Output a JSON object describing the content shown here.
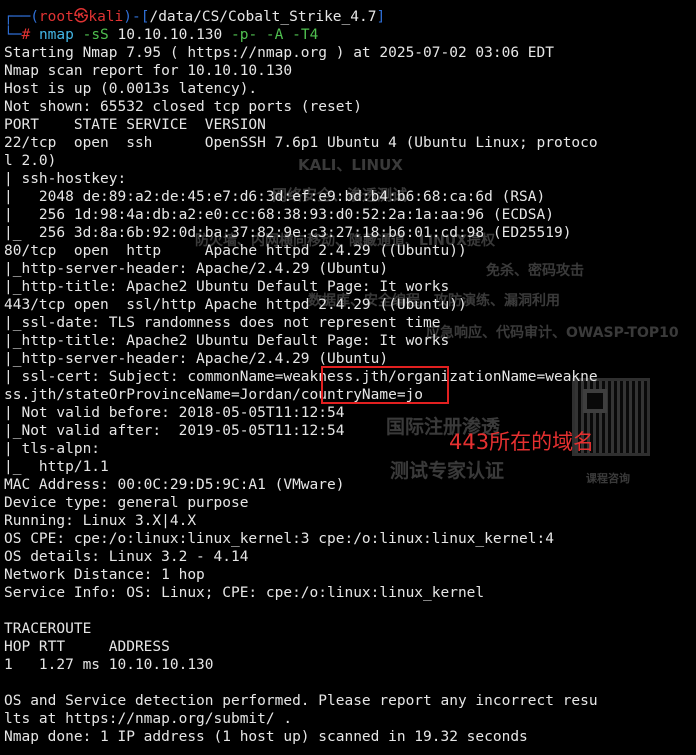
{
  "prompt": {
    "open": "┌──(",
    "user": "root㉿kali",
    "mid": ")-[",
    "path": "/data/CS/Cobalt_Strike_4.7",
    "close": "]",
    "arrow": "└─",
    "hash": "# ",
    "command": "nmap",
    "args": " -sS",
    "target": " 10.10.10.130",
    "ports": " -p-",
    "more_args": " -A -T4"
  },
  "output_lines": [
    "Starting Nmap 7.95 ( https://nmap.org ) at 2025-07-02 03:06 EDT",
    "Nmap scan report for 10.10.10.130",
    "Host is up (0.0013s latency).",
    "Not shown: 65532 closed tcp ports (reset)",
    "PORT    STATE SERVICE  VERSION",
    "22/tcp  open  ssh      OpenSSH 7.6p1 Ubuntu 4 (Ubuntu Linux; protoco",
    "l 2.0)",
    "| ssh-hostkey: ",
    "|   2048 de:89:a2:de:45:e7:d6:3d:ef:e9:bd:b4:b6:68:ca:6d (RSA)",
    "|   256 1d:98:4a:db:a2:e0:cc:68:38:93:d0:52:2a:1a:aa:96 (ECDSA)",
    "|_  256 3d:8a:6b:92:0d:ba:37:82:9e:c3:27:18:b6:01:cd:98 (ED25519)",
    "80/tcp  open  http     Apache httpd 2.4.29 ((Ubuntu))",
    "|_http-server-header: Apache/2.4.29 (Ubuntu)",
    "|_http-title: Apache2 Ubuntu Default Page: It works",
    "443/tcp open  ssl/http Apache httpd 2.4.29 ((Ubuntu))",
    "|_ssl-date: TLS randomness does not represent time",
    "|_http-title: Apache2 Ubuntu Default Page: It works",
    "|_http-server-header: Apache/2.4.29 (Ubuntu)",
    "| ssl-cert: Subject: commonName=weakness.jth/organizationName=weakne",
    "ss.jth/stateOrProvinceName=Jordan/countryName=jo",
    "| Not valid before: 2018-05-05T11:12:54",
    "|_Not valid after:  2019-05-05T11:12:54",
    "| tls-alpn: ",
    "|_  http/1.1",
    "MAC Address: 00:0C:29:D5:9C:A1 (VMware)",
    "Device type: general purpose",
    "Running: Linux 3.X|4.X",
    "OS CPE: cpe:/o:linux:linux_kernel:3 cpe:/o:linux:linux_kernel:4",
    "OS details: Linux 3.2 - 4.14",
    "Network Distance: 1 hop",
    "Service Info: OS: Linux; CPE: cpe:/o:linux:linux_kernel",
    "",
    "TRACEROUTE",
    "HOP RTT     ADDRESS",
    "1   1.27 ms 10.10.10.130",
    "",
    "OS and Service detection performed. Please report any incorrect resu",
    "lts at https://nmap.org/submit/ .",
    "Nmap done: 1 IP address (1 host up) scanned in 19.32 seconds"
  ],
  "annotation": {
    "label": "443所在的域名"
  },
  "watermark": {
    "line1": "KALI、LINUX",
    "line2": "网络安全、渗透测试",
    "line3": "防火墙、内网横向移动、隐藏通道、LINUX提权",
    "line4": "免杀、密码攻击",
    "line5": "数据库、安全编程、攻防演练、漏洞利用",
    "line6": "应急响应、代码审计、OWASP-TOP10",
    "line7": "国际注册渗透",
    "line8": "测试专家认证",
    "line9": "课程咨询"
  },
  "colors": {
    "background": "#000000",
    "text": "#e6e6e6",
    "prompt_frame": "#2f6fd6",
    "prompt_user": "#e03333",
    "command": "#43b6e6",
    "flags": "#4fbf4f",
    "annotation": "#e22020"
  }
}
